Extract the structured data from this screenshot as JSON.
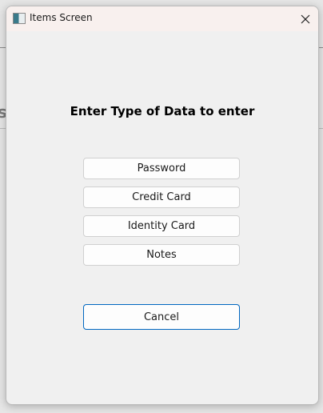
{
  "window": {
    "title": "Items Screen"
  },
  "dialog": {
    "heading": "Enter Type of Data to enter",
    "options": [
      {
        "label": "Password"
      },
      {
        "label": "Credit Card"
      },
      {
        "label": "Identity Card"
      },
      {
        "label": "Notes"
      }
    ],
    "cancel_label": "Cancel"
  },
  "background": {
    "partial_text": "s"
  },
  "colors": {
    "accent": "#0067c0",
    "titlebar": "#f8f0ee",
    "body": "#f0f0f0"
  }
}
